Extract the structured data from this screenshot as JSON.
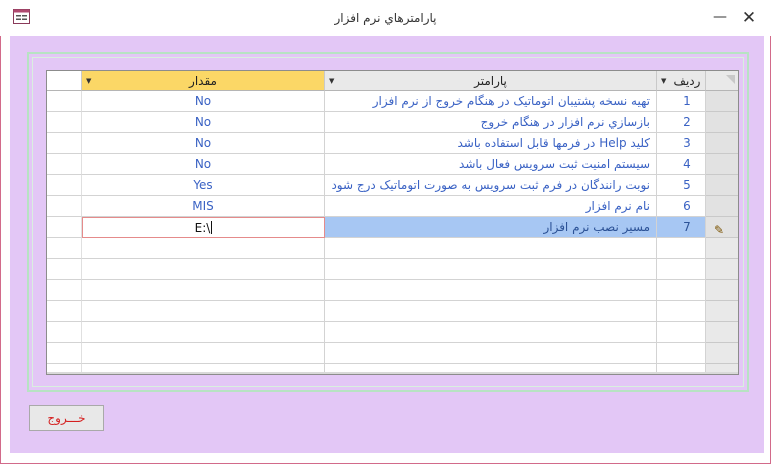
{
  "window": {
    "title": "پارامترهاي نرم افزار",
    "minimize_glyph": "—",
    "close_glyph": "✕"
  },
  "grid": {
    "columns": {
      "row_no": "رديف",
      "param": "پارامتر",
      "value": "مقدار"
    },
    "rows": [
      {
        "no": "1",
        "param": "تهيه نسخه پشتيبان اتوماتيک در هنگام خروج از نرم افزار",
        "value": "No"
      },
      {
        "no": "2",
        "param": "بازسازي نرم افزار در هنگام خروج",
        "value": "No"
      },
      {
        "no": "3",
        "param": "کليد Help در فرمها قابل استفاده باشد",
        "value": "No"
      },
      {
        "no": "4",
        "param": "سيستم امنيت ثبت سرويس فعال باشد",
        "value": "No"
      },
      {
        "no": "5",
        "param": "نوبت رانندگان در فرم ثبت سرويس به صورت اتوماتيک درج شود",
        "value": "Yes"
      },
      {
        "no": "6",
        "param": "نام نرم افزار",
        "value": "MIS"
      },
      {
        "no": "7",
        "param": "مسير نصب نرم افزار",
        "value": "E:\\"
      }
    ],
    "current_row": 7
  },
  "exit_button": {
    "label": "خـــروج"
  }
}
